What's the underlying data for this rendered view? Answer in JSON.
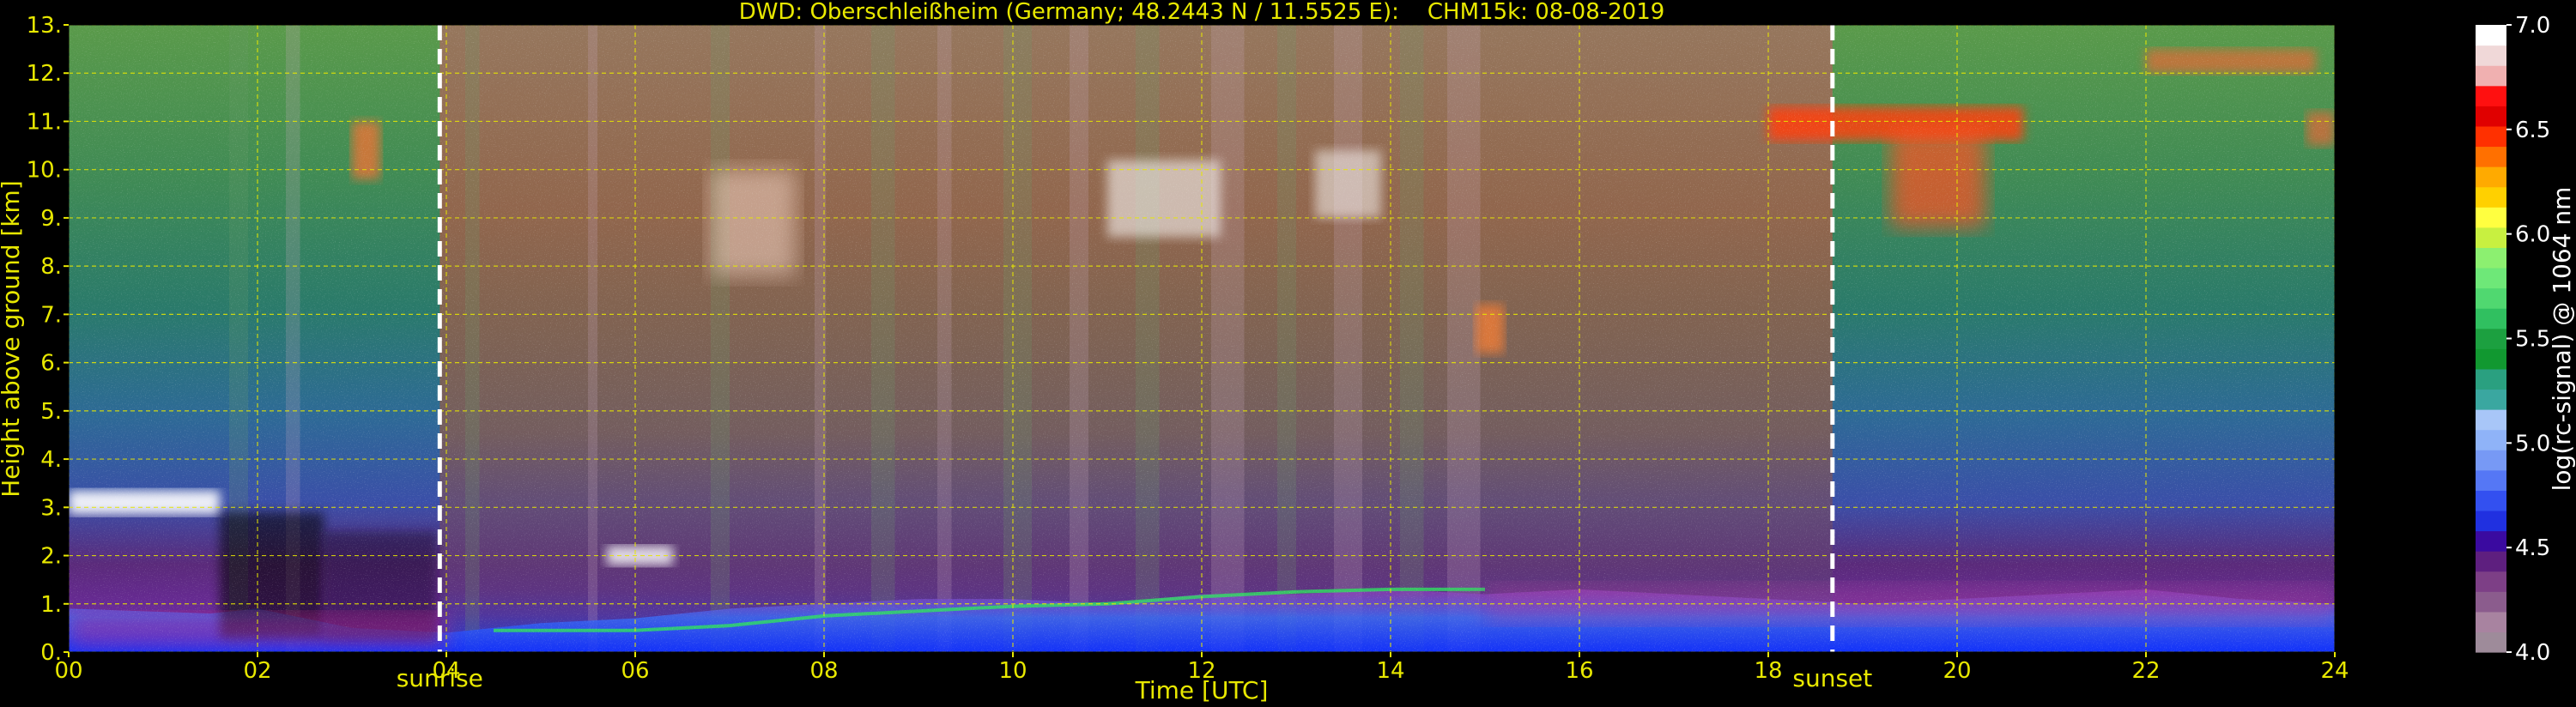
{
  "chart_data": {
    "type": "heatmap",
    "title": "DWD: Oberschleißheim (Germany; 48.2443 N / 11.5525 E):    CHM15k: 08-08-2019",
    "xlabel": "Time [UTC]",
    "ylabel": "Height above ground [km]",
    "xlim": [
      0,
      24
    ],
    "ylim": [
      0,
      13
    ],
    "x_ticks": [
      "00",
      "02",
      "04",
      "06",
      "08",
      "10",
      "12",
      "14",
      "16",
      "18",
      "20",
      "22",
      "24"
    ],
    "y_ticks": [
      "0.",
      "1.",
      "2.",
      "3.",
      "4.",
      "5.",
      "6.",
      "7.",
      "8.",
      "9.",
      "10.",
      "11.",
      "12.",
      "13."
    ],
    "grid": true,
    "events": [
      {
        "label": "sunrise",
        "time": 3.93
      },
      {
        "label": "sunset",
        "time": 18.68
      }
    ],
    "colorbar": {
      "label": "log(rc-signal) @ 1064 nm",
      "range": [
        4.0,
        7.0
      ],
      "ticks": [
        "4.0",
        "4.5",
        "5.0",
        "5.5",
        "6.0",
        "6.5",
        "7.0"
      ],
      "colors": [
        "#9e8b9a",
        "#a883a0",
        "#8b5c8d",
        "#7d3f86",
        "#5e1f7f",
        "#3a0aa0",
        "#2030e0",
        "#3350f0",
        "#5577f5",
        "#7799f5",
        "#8fb3f8",
        "#a8c6f8",
        "#3aa7a0",
        "#2aa080",
        "#119830",
        "#1ca040",
        "#30c060",
        "#50d870",
        "#6ee878",
        "#8cf070",
        "#c8f040",
        "#ffff40",
        "#ffd000",
        "#ffaa00",
        "#ff7000",
        "#ff3000",
        "#e00000",
        "#ff1010",
        "#f0b0b0",
        "#f0d8d8",
        "#ffffff"
      ]
    }
  }
}
